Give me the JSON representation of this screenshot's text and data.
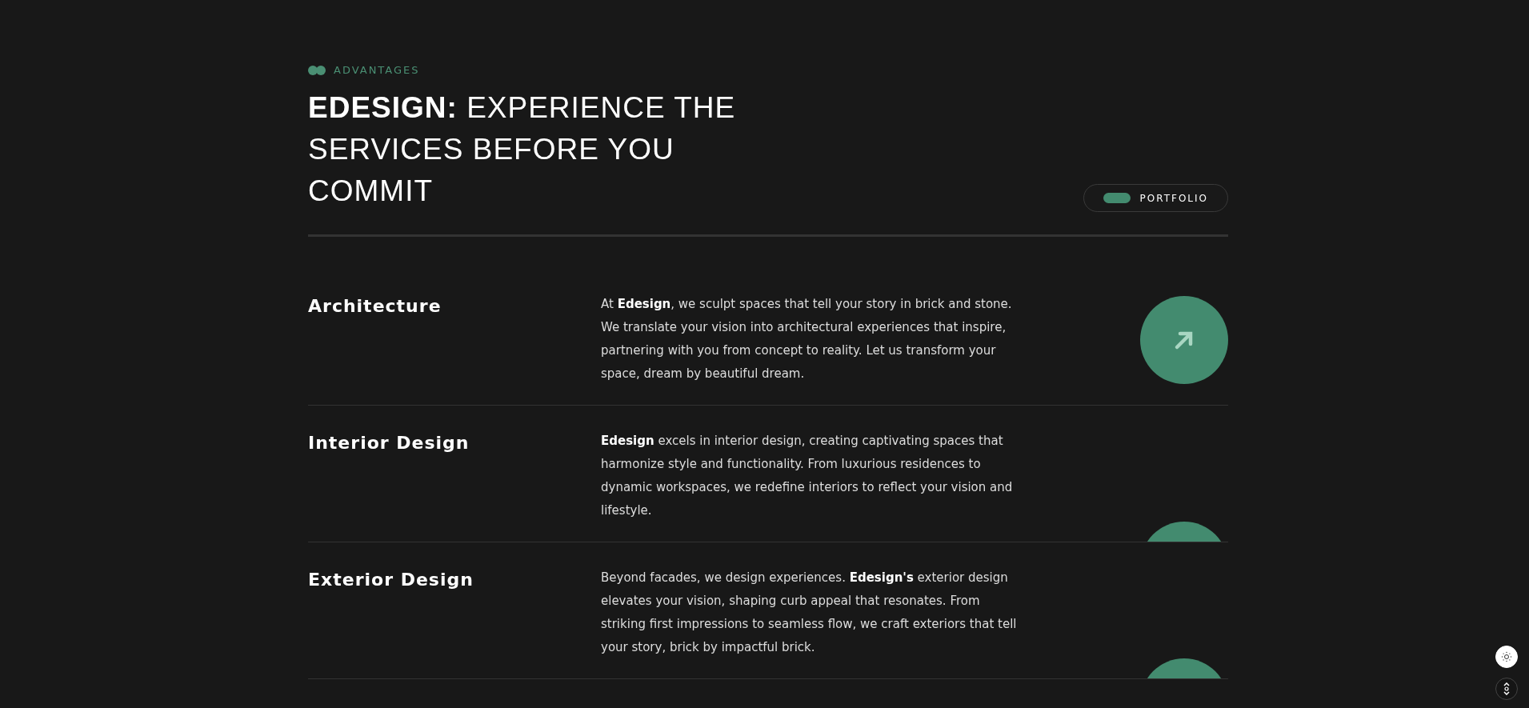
{
  "section_label": "ADVANTAGES",
  "heading": {
    "brand": "EDESIGN:",
    "text": "EXPERIENCE THE SERVICES BEFORE YOU COMMIT"
  },
  "portfolio_button": {
    "label": "PORTFOLIO"
  },
  "services": [
    {
      "title": "Architecture",
      "description": "At **Edesign**, we sculpt spaces that tell your story in brick and stone. We translate your vision into architectural experiences that inspire, partnering with you from concept to reality. Let us transform your space, dream by beautiful dream.",
      "expanded": true
    },
    {
      "title": "Interior Design",
      "description": "**Edesign** excels in interior design, creating captivating spaces that harmonize style and functionality. From luxurious residences to dynamic workspaces, we redefine interiors to reflect your vision and lifestyle.",
      "expanded": false
    },
    {
      "title": "Exterior Design",
      "description": "Beyond facades, we design experiences. **Edesign's** exterior design elevates your vision, shaping curb appeal that resonates. From striking first impressions to seamless flow, we craft exteriors that tell your story, brick by impactful brick.",
      "expanded": false
    }
  ]
}
